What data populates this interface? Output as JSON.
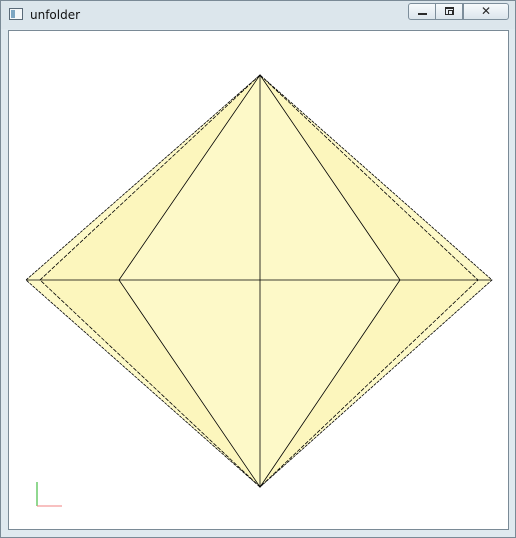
{
  "window": {
    "title": "unfolder",
    "controls": {
      "minimize_icon": "minimize-icon",
      "maximize_icon": "maximize-icon",
      "close_icon": "close-icon",
      "close_glyph": "✕"
    }
  },
  "viewport": {
    "background": "#ffffff",
    "paper_color": "#fdf9c8",
    "edge_color": "#000000",
    "axis_x_color": "#f08080",
    "axis_y_color": "#22b022"
  }
}
